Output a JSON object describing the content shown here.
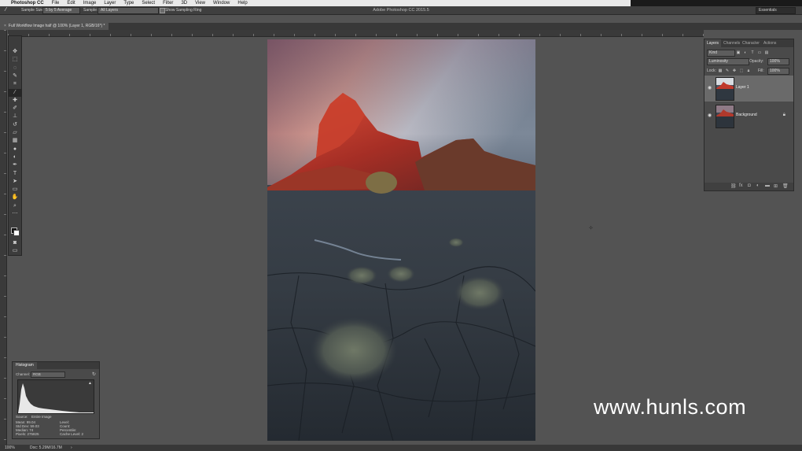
{
  "menubar": {
    "apple": "",
    "items": [
      "Photoshop CC",
      "File",
      "Edit",
      "Image",
      "Layer",
      "Type",
      "Select",
      "Filter",
      "3D",
      "View",
      "Window",
      "Help"
    ]
  },
  "window_title": "Adobe Photoshop CC 2015.5",
  "options_bar": {
    "sample_size_label": "Sample Size:",
    "sample_size_value": "5 by 5 Average",
    "sample_label": "Sample:",
    "sample_value": "All Layers",
    "show_ring_label": "Show Sampling Ring",
    "workspace": "Essentials"
  },
  "document_tab": {
    "close": "×",
    "label": "Full Workflow Image half @ 100% (Layer 1, RGB/16*) *"
  },
  "tools": [
    {
      "name": "move-tool",
      "glyph": "✥"
    },
    {
      "name": "marquee-tool",
      "glyph": "⬚"
    },
    {
      "name": "lasso-tool",
      "glyph": "◌"
    },
    {
      "name": "quick-select-tool",
      "glyph": "✎"
    },
    {
      "name": "crop-tool",
      "glyph": "⌗"
    },
    {
      "name": "eyedropper-tool",
      "glyph": "⁄"
    },
    {
      "name": "healing-tool",
      "glyph": "✚"
    },
    {
      "name": "brush-tool",
      "glyph": "✐"
    },
    {
      "name": "stamp-tool",
      "glyph": "⊥"
    },
    {
      "name": "history-brush-tool",
      "glyph": "↺"
    },
    {
      "name": "eraser-tool",
      "glyph": "▱"
    },
    {
      "name": "gradient-tool",
      "glyph": "▦"
    },
    {
      "name": "blur-tool",
      "glyph": "●"
    },
    {
      "name": "dodge-tool",
      "glyph": "◐"
    },
    {
      "name": "pen-tool",
      "glyph": "✒"
    },
    {
      "name": "type-tool",
      "glyph": "T"
    },
    {
      "name": "path-select-tool",
      "glyph": "➤"
    },
    {
      "name": "shape-tool",
      "glyph": "▭"
    },
    {
      "name": "hand-tool",
      "glyph": "✋"
    },
    {
      "name": "zoom-tool",
      "glyph": "⌕"
    },
    {
      "name": "more-tools",
      "glyph": "⋯"
    }
  ],
  "layers_panel": {
    "tabs": [
      "Layers",
      "Channels",
      "Character",
      "Actions"
    ],
    "kind": "Kind",
    "blend_mode": "Luminosity",
    "opacity_label": "Opacity:",
    "opacity_value": "100%",
    "lock_label": "Lock:",
    "fill_label": "Fill:",
    "fill_value": "100%",
    "layers": [
      {
        "name": "Layer 1",
        "active": true
      },
      {
        "name": "Background",
        "active": false
      }
    ]
  },
  "histogram": {
    "title": "Histogram",
    "channel_label": "Channel:",
    "channel_value": "RGB",
    "source_label": "Source:",
    "source_value": "Entire Image",
    "stats_left": [
      {
        "label": "Mean:",
        "value": "99.04"
      },
      {
        "label": "Std Dev:",
        "value": "59.03"
      },
      {
        "label": "Median:",
        "value": "74"
      },
      {
        "label": "Pixels:",
        "value": "275825"
      }
    ],
    "stats_right": [
      {
        "label": "Level:",
        "value": ""
      },
      {
        "label": "Count:",
        "value": ""
      },
      {
        "label": "Percentile:",
        "value": ""
      },
      {
        "label": "Cache Level:",
        "value": "2"
      }
    ]
  },
  "status": {
    "zoom": "100%",
    "doc": "Doc: 5.29M/16.7M"
  },
  "watermark": "www.hunls.com"
}
